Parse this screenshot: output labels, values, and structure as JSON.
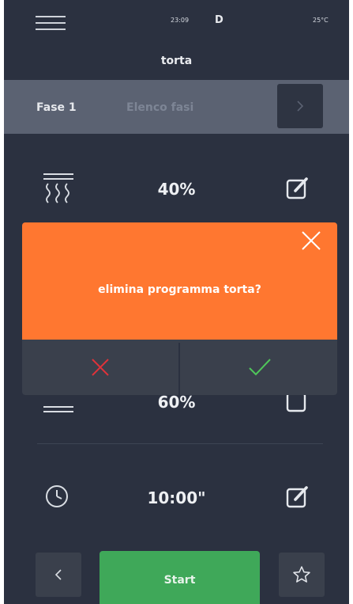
{
  "header": {
    "time": "23:09",
    "day": "D",
    "temperature": "25°C",
    "title": "torta"
  },
  "phase": {
    "label": "Fase 1",
    "list_label": "Elenco fasi"
  },
  "settings": [
    {
      "value": "40%",
      "icon": "steam-heat-icon"
    },
    {
      "value": "60%",
      "icon": "fan-icon"
    },
    {
      "value": "10:00\"",
      "icon": "clock-icon"
    }
  ],
  "dialog": {
    "message": "elimina programma torta?"
  },
  "footer": {
    "start_label": "Start"
  },
  "colors": {
    "background": "#2b3140",
    "dialog": "#ff7730",
    "start": "#3fa859",
    "cancel": "#e0323a",
    "confirm": "#4fc65a"
  }
}
